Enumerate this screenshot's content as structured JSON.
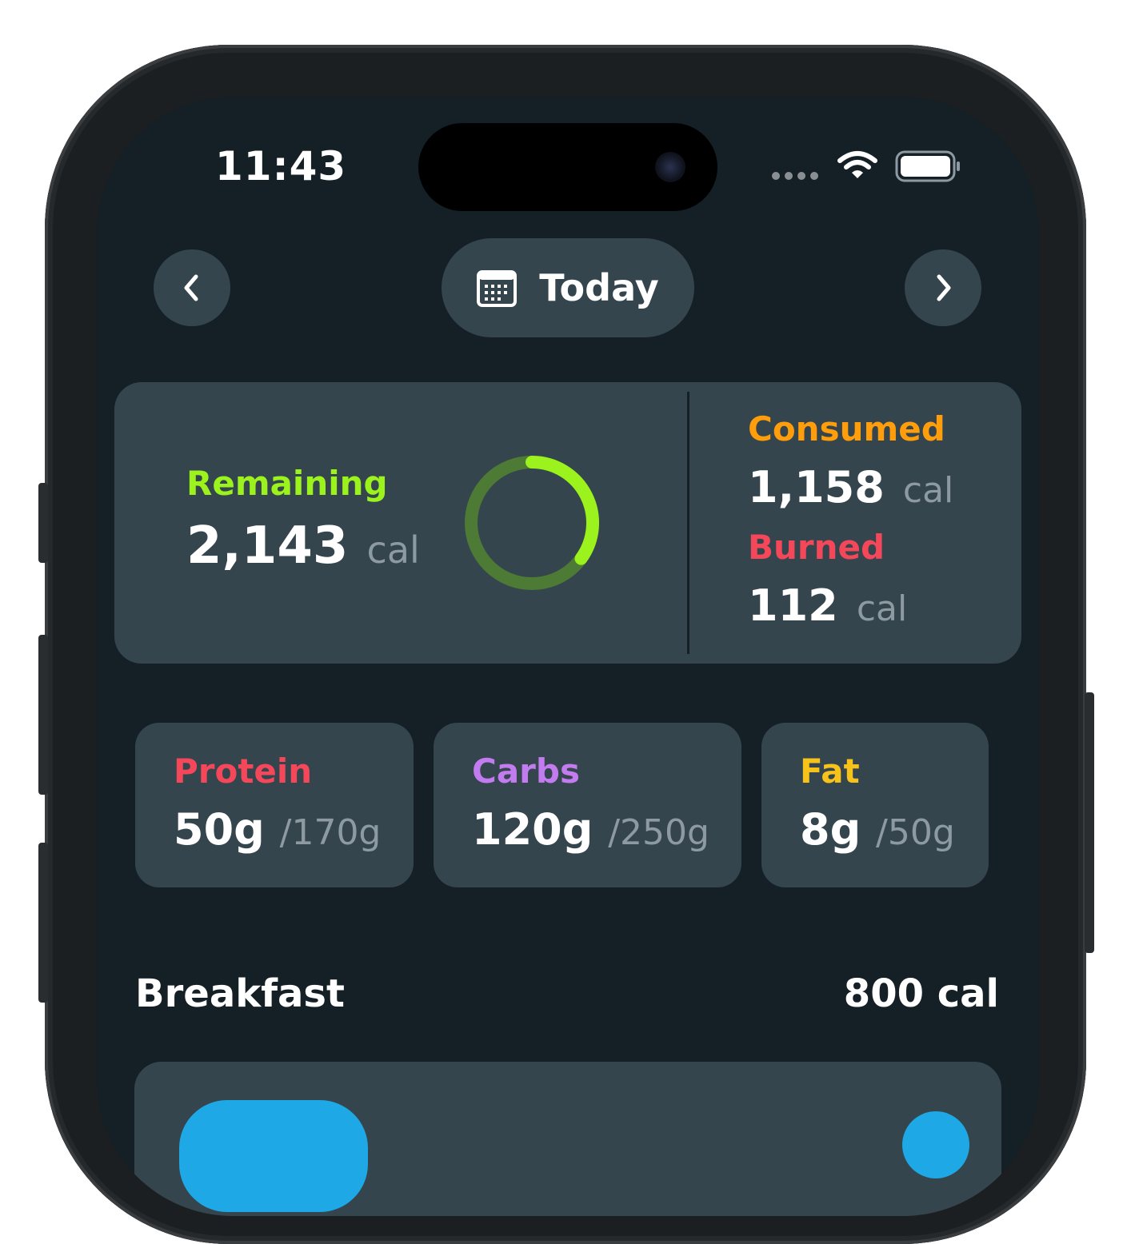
{
  "status_bar": {
    "time": "11:43"
  },
  "date_nav": {
    "prev_icon": "chevron-left-icon",
    "next_icon": "chevron-right-icon",
    "calendar_icon": "calendar-icon",
    "label": "Today"
  },
  "summary": {
    "remaining_label": "Remaining",
    "remaining_value": "2,143",
    "remaining_unit": "cal",
    "consumed_label": "Consumed",
    "consumed_value": "1,158",
    "consumed_unit": "cal",
    "burned_label": "Burned",
    "burned_value": "112",
    "burned_unit": "cal",
    "ring_progress_fraction": 0.35
  },
  "macros": [
    {
      "label": "Protein",
      "value": "50g",
      "total": "/170g",
      "color": "#f4475a"
    },
    {
      "label": "Carbs",
      "value": "120g",
      "total": "/250g",
      "color": "#c27cf0"
    },
    {
      "label": "Fat",
      "value": "8g",
      "total": "/50g",
      "color": "#f7c21a"
    }
  ],
  "meal_section": {
    "title": "Breakfast",
    "calories": "800 cal"
  },
  "colors": {
    "remaining": "#9cf21c",
    "consumed": "#ff9d0a",
    "burned": "#f4475a",
    "accent_blue": "#1fa8e6"
  }
}
